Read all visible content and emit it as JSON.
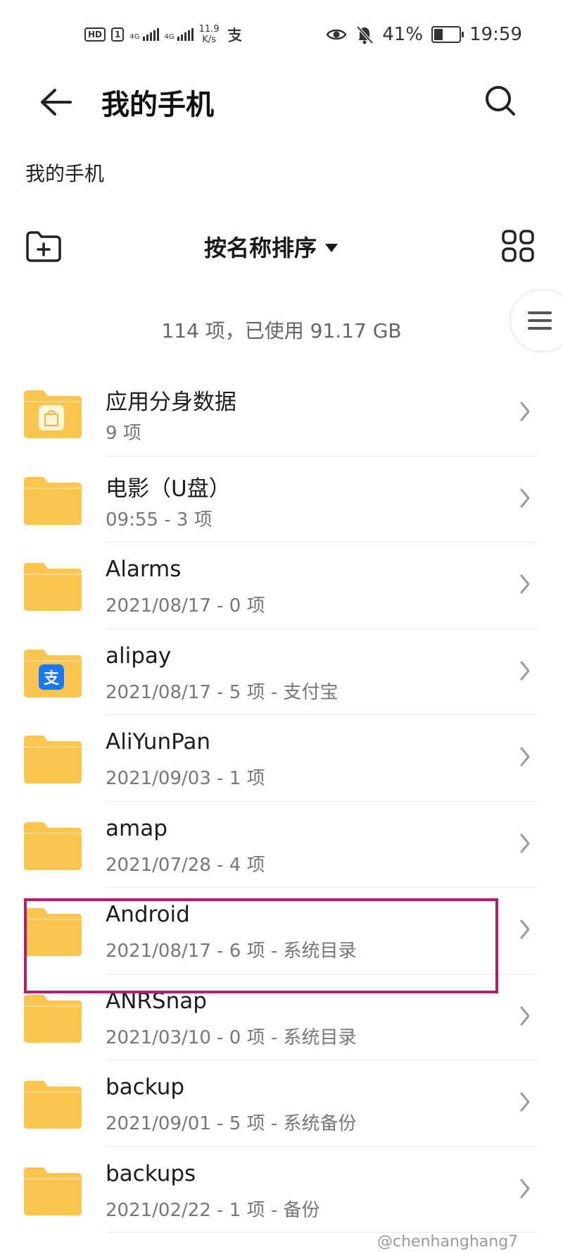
{
  "status_bar": {
    "hd_label": "HD",
    "sim_number": "1",
    "network_1": "4G",
    "network_2": "4G",
    "speed_value": "11.9",
    "speed_unit": "K/s",
    "battery_level": 41,
    "battery_percent": "41%",
    "time": "19:59",
    "icons": [
      "alipay-notification-icon",
      "eye-icon",
      "bell-off-icon",
      "battery-icon"
    ]
  },
  "app_bar": {
    "title": "我的手机",
    "back_icon": "back-arrow-icon",
    "search_icon": "search-icon"
  },
  "breadcrumb": "我的手机",
  "toolbar": {
    "sort_label": "按名称排序",
    "new_folder_icon": "new-folder-icon",
    "view_icon": "grid-view-icon"
  },
  "summary": "114 项，已使用 91.17 GB",
  "folders": [
    {
      "name": "应用分身数据",
      "meta": "9 项",
      "badge": "bag"
    },
    {
      "name": "电影（U盘）",
      "meta": "09:55 - 3 项",
      "badge": ""
    },
    {
      "name": "Alarms",
      "meta": "2021/08/17 - 0 项",
      "badge": ""
    },
    {
      "name": "alipay",
      "meta": "2021/08/17 - 5 项 - 支付宝",
      "badge": "alipay"
    },
    {
      "name": "AliYunPan",
      "meta": "2021/09/03 - 1 项",
      "badge": ""
    },
    {
      "name": "amap",
      "meta": "2021/07/28 - 4 项",
      "badge": ""
    },
    {
      "name": "Android",
      "meta": "2021/08/17 - 6 项 - 系统目录",
      "badge": ""
    },
    {
      "name": "ANRSnap",
      "meta": "2021/03/10 - 0 项 - 系统目录",
      "badge": ""
    },
    {
      "name": "backup",
      "meta": "2021/09/01 - 5 项 - 系统备份",
      "badge": ""
    },
    {
      "name": "backups",
      "meta": "2021/02/22 - 1 项 - 备份",
      "badge": ""
    }
  ],
  "alipay_badge_char": "支",
  "highlight_color": "#b0206e",
  "folder_color": "#fcc64e",
  "watermark": "@chenhanghang7"
}
